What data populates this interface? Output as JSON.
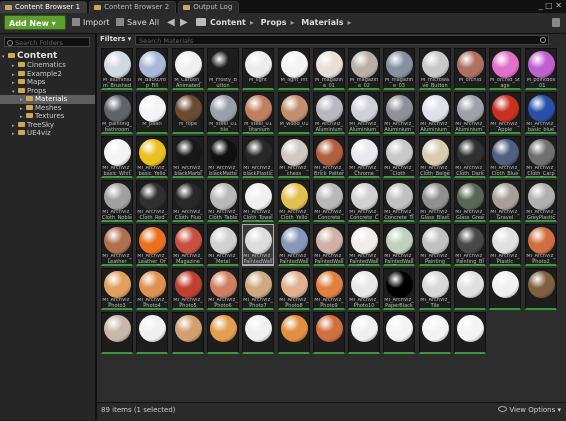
{
  "tabs": [
    {
      "label": "Content Browser 1",
      "active": true
    },
    {
      "label": "Content Browser 2",
      "active": false
    },
    {
      "label": "Output Log",
      "active": false
    }
  ],
  "window_buttons": "_ □ ✕",
  "toolbar": {
    "add_new": "Add New ▾",
    "import": "Import",
    "save_all": "Save All",
    "back": "◀",
    "forward": "▶",
    "breadcrumb": [
      "Content",
      "Props",
      "Materials"
    ]
  },
  "left_panel": {
    "search_placeholder": "Search Folders",
    "tree": [
      {
        "label": "Content",
        "root": true
      },
      {
        "label": "Cinematics"
      },
      {
        "label": "Example2"
      },
      {
        "label": "Maps"
      },
      {
        "label": "Props"
      },
      {
        "label": "Materials",
        "selected": true
      },
      {
        "label": "Meshes"
      },
      {
        "label": "Textures"
      },
      {
        "label": "TreeSky"
      },
      {
        "label": "UE4viz"
      }
    ]
  },
  "main": {
    "filters_label": "Filters ▾",
    "search_placeholder": "Search Materials",
    "items": [
      {
        "label": "M_aluminium_Brushed",
        "color": "#d0d8e0"
      },
      {
        "label": "M_BackDrop_Fill",
        "color": "#a8b8d8"
      },
      {
        "label": "M_Carbon_Animated",
        "color": "#f0f0f0"
      },
      {
        "label": "M_Frosty_Button",
        "color": "#1c1c1c"
      },
      {
        "label": "M_light",
        "color": "#ececec"
      },
      {
        "label": "M_light_Int",
        "color": "#f4f4f4"
      },
      {
        "label": "M_magazine_01",
        "color": "#e8e0d8"
      },
      {
        "label": "M_magazine_02",
        "color": "#b8b0a8"
      },
      {
        "label": "M_magazine_03",
        "color": "#8890a0"
      },
      {
        "label": "M_microwave_Button",
        "color": "#c8c8c8"
      },
      {
        "label": "M_orchid",
        "color": "#b07060"
      },
      {
        "label": "M_orchid_Stage",
        "color": "#e070c8"
      },
      {
        "label": "M_pointBox_01",
        "color": "#c060d0"
      },
      {
        "label": "M_painting_bathroom",
        "color": "#606468"
      },
      {
        "label": "M_pearl",
        "color": "#f4f4f8"
      },
      {
        "label": "M_rope",
        "color": "#6a4a30"
      },
      {
        "label": "M_steel_01_tile",
        "color": "#9aa0a8"
      },
      {
        "label": "M_steel_01_titanium",
        "color": "#c08060"
      },
      {
        "label": "M_wood_01",
        "color": "#c09070"
      },
      {
        "label": "M_ArchViz_Aluminium",
        "color": "#b8b8c0"
      },
      {
        "label": "MI_ArchViz_Aluminium_bent",
        "color": "#d0d0d8"
      },
      {
        "label": "MI_ArchViz_Aluminium_dark",
        "color": "#909098"
      },
      {
        "label": "MI_ArchViz_Aluminium_Shiny",
        "color": "#e0e0e8"
      },
      {
        "label": "MI_ArchViz_Aluminium_wet",
        "color": "#a0a0a8"
      },
      {
        "label": "MI_ArchViz_Apple",
        "color": "#c83020"
      },
      {
        "label": "MI_ArchViz_basic_blue",
        "color": "#2850a8"
      },
      {
        "label": "MI_ArchViz_basic_White",
        "color": "#f4f4f4"
      },
      {
        "label": "MI_ArchViz_basic_Yellow",
        "color": "#e8c020"
      },
      {
        "label": "MI_ArchViz_blackMarble",
        "color": "#181818"
      },
      {
        "label": "MI_ArchViz_blackMatte",
        "color": "#101010"
      },
      {
        "label": "MI_ArchViz_blackPlastic",
        "color": "#282828"
      },
      {
        "label": "MI_ArchViz_chess",
        "color": "#d0c8c0"
      },
      {
        "label": "MI_ArchViz_Brick_Pattern",
        "color": "#b06040"
      },
      {
        "label": "MI_ArchViz_Chrome",
        "color": "#e8e8ee"
      },
      {
        "label": "MI_ArchViz_Cloth",
        "color": "#c8c8c8"
      },
      {
        "label": "MI_ArchViz_Cloth_Beige",
        "color": "#d8cbb0"
      },
      {
        "label": "MI_ArchViz_Cloth_Dark",
        "color": "#303030"
      },
      {
        "label": "MI_ArchViz_Cloth_Blue",
        "color": "#506080"
      },
      {
        "label": "MI_ArchViz_Cloth_Carpet",
        "color": "#707070"
      },
      {
        "label": "MI_ArchViz_Cloth_Noble",
        "color": "#a0a0a0"
      },
      {
        "label": "MI_ArchViz_Cloth_Red",
        "color": "#303030"
      },
      {
        "label": "MI_ArchViz_Cloth_Fluo",
        "color": "#282828"
      },
      {
        "label": "MI_ArchViz_Cloth_Table",
        "color": "#b8b8b8"
      },
      {
        "label": "MI_ArchViz_Cloth_Towel",
        "color": "#f0f0f0"
      },
      {
        "label": "MI_ArchViz_Cloth_Yellow",
        "color": "#e0c050"
      },
      {
        "label": "MI_ArchViz_Concrete",
        "color": "#b8b8b8"
      },
      {
        "label": "MI_ArchViz_Concrete_Ceiling",
        "color": "#d0d0d0"
      },
      {
        "label": "MI_ArchViz_Concrete_Tile",
        "color": "#c0c0c0"
      },
      {
        "label": "MI_ArchViz_Glass_Blasted",
        "color": "#909090"
      },
      {
        "label": "MI_ArchViz_Glass_Green",
        "color": "#586858"
      },
      {
        "label": "MI_ArchViz_Gravel",
        "color": "#a8a098"
      },
      {
        "label": "MI_ArchViz_GreyPlastic",
        "color": "#b0b0b0"
      },
      {
        "label": "MI_ArchViz_Leather",
        "color": "#b07050"
      },
      {
        "label": "MI_ArchViz_Leather_Orange",
        "color": "#e87020"
      },
      {
        "label": "MI_ArchViz_Magazine",
        "color": "#c85040"
      },
      {
        "label": "MI_ArchViz_Metal",
        "color": "#d0d0d0"
      },
      {
        "label": "MI_ArchViz_PaintedWall",
        "color": "#dcdcdc",
        "selected": true
      },
      {
        "label": "MI_ArchViz_PaintedWall_Blue",
        "color": "#8898b8"
      },
      {
        "label": "MI_ArchViz_PaintedWall_Red",
        "color": "#d0b0a8"
      },
      {
        "label": "MI_ArchViz_PaintedWall_White",
        "color": "#f0ecec"
      },
      {
        "label": "MI_ArchViz_PaintedWall_Green",
        "color": "#c0d0c0"
      },
      {
        "label": "MI_ArchViz_Painting",
        "color": "#c0c0c0"
      },
      {
        "label": "MI_ArchViz_Painting_Blackboard",
        "color": "#484848"
      },
      {
        "label": "MI_ArchViz_Plastic",
        "color": "#e0e0e0"
      },
      {
        "label": "MI_ArchViz_Photo2",
        "color": "#d07040"
      },
      {
        "label": "MI_ArchViz_Photo3",
        "color": "#e0a060"
      },
      {
        "label": "MI_ArchViz_Photo4",
        "color": "#e09050"
      },
      {
        "label": "MI_ArchViz_Photo5",
        "color": "#c04030"
      },
      {
        "label": "MI_ArchViz_Photo6",
        "color": "#d08060"
      },
      {
        "label": "MI_ArchViz_Photo7",
        "color": "#d0a880"
      },
      {
        "label": "MI_ArchViz_Photo8",
        "color": "#e0b090"
      },
      {
        "label": "MI_ArchViz_Photo9",
        "color": "#e08040"
      },
      {
        "label": "MI_ArchViz_Photo10",
        "color": "#e8e8e8"
      },
      {
        "label": "MI_ArchViz_PaperBlack",
        "color": "#000000"
      },
      {
        "label": "MI_ArchViz_Tile",
        "color": "#d8d8d8"
      },
      {
        "label": "",
        "color": "#e0e0e0"
      },
      {
        "label": "",
        "color": "#f0f0f0"
      },
      {
        "label": "",
        "color": "#806040"
      },
      {
        "label": "",
        "color": "#c8b8a8"
      },
      {
        "label": "",
        "color": "#f0f0f0"
      },
      {
        "label": "",
        "color": "#d0a070"
      },
      {
        "label": "",
        "color": "#e0a050"
      },
      {
        "label": "",
        "color": "#f0f0f0"
      },
      {
        "label": "",
        "color": "#e09040"
      },
      {
        "label": "",
        "color": "#d07040"
      },
      {
        "label": "",
        "color": "#f0f0f0"
      },
      {
        "label": "",
        "color": "#f4f4f4"
      },
      {
        "label": "",
        "color": "#f4f4f4"
      },
      {
        "label": "",
        "color": "#f4f4f4"
      }
    ],
    "status_count": "89 items (1 selected)",
    "view_options": "View Options ▾"
  }
}
